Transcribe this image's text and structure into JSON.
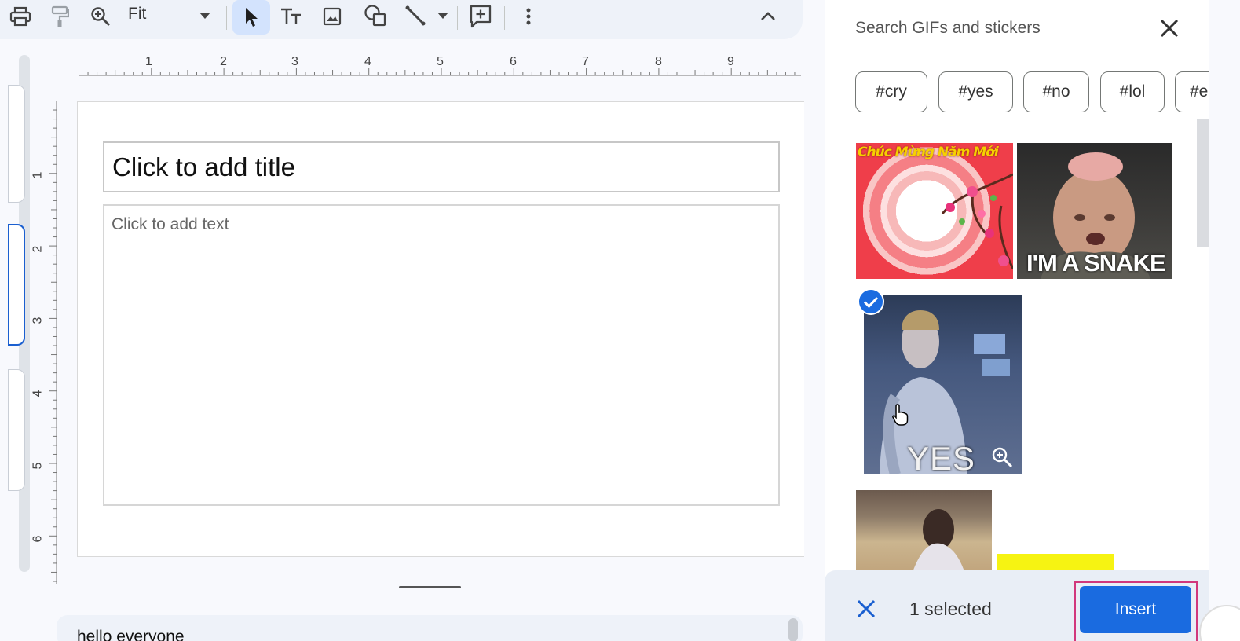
{
  "toolbar": {
    "zoom_value": "Fit",
    "icons": [
      "print-icon",
      "paint-format-icon",
      "zoom-icon",
      "dropdown-arrow-icon",
      "select-cursor-icon",
      "text-box-icon",
      "image-icon",
      "shapes-icon",
      "line-icon",
      "line-dropdown-icon",
      "add-comment-icon",
      "more-options-icon",
      "collapse-icon"
    ]
  },
  "rulers": {
    "horizontal": [
      "1",
      "2",
      "3",
      "4",
      "5",
      "6",
      "7",
      "8",
      "9"
    ],
    "vertical": [
      "1",
      "2",
      "3",
      "4",
      "5",
      "6"
    ]
  },
  "slide": {
    "title_placeholder": "Click to add title",
    "body_placeholder": "Click to add text"
  },
  "notes": {
    "text": "hello everyone"
  },
  "gif_panel": {
    "search_placeholder": "Search GIFs and stickers",
    "chips": [
      "#cry",
      "#yes",
      "#no",
      "#lol",
      "#e"
    ],
    "results": [
      {
        "caption": "Chúc Mừng Năm Mới",
        "selected": false
      },
      {
        "caption": "I'M A SNAKE",
        "selected": false
      },
      {
        "caption": "YES",
        "selected": true
      },
      {
        "caption": "",
        "selected": false
      },
      {
        "caption": "",
        "selected": false
      }
    ],
    "selected_count_text": "1 selected",
    "insert_label": "Insert"
  },
  "colors": {
    "accent": "#1a6be0",
    "highlight_frame": "#d1377c",
    "toolbar_bg": "#eef2f9",
    "selected_tool_bg": "#d3e3fd"
  }
}
